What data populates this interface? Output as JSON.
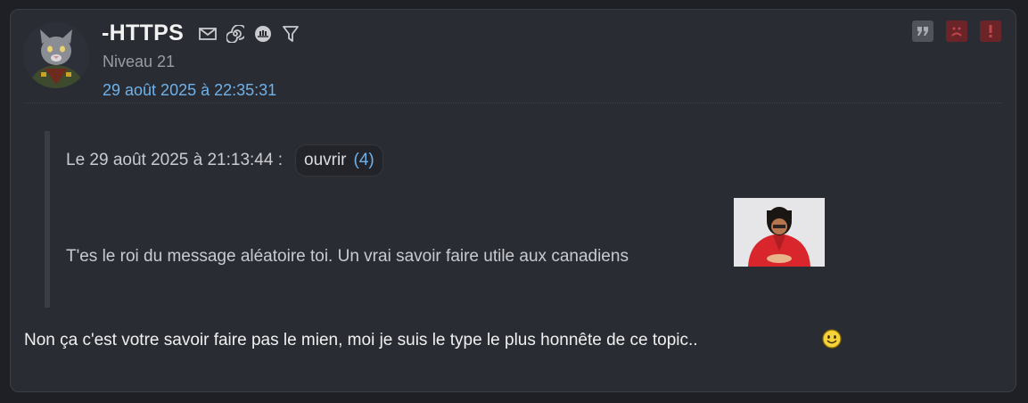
{
  "post": {
    "author": "-HTTPS",
    "level": "Niveau 21",
    "date": "29 août 2025 à 22:35:31",
    "author_icons": [
      "mail-icon",
      "spiral-icon",
      "badge-icon",
      "filter-icon"
    ],
    "actions": {
      "quote_glyph": "”",
      "sad_icon": "sad-face-icon",
      "alert_glyph": "!"
    }
  },
  "quote": {
    "date_label": "Le 29 août 2025 à 21:13:44 :",
    "open_label": "ouvrir",
    "open_count": "(4)",
    "text": "T'es le roi du message aléatoire toi. Un vrai savoir faire utile aux canadiens"
  },
  "body": {
    "text": "Non ça c'est votre savoir faire pas le mien, moi je suis le type le plus honnête de ce topic.."
  },
  "colors": {
    "accent": "#6fb2ea",
    "background": "#2a2c33",
    "action_red": "#6b2529"
  }
}
